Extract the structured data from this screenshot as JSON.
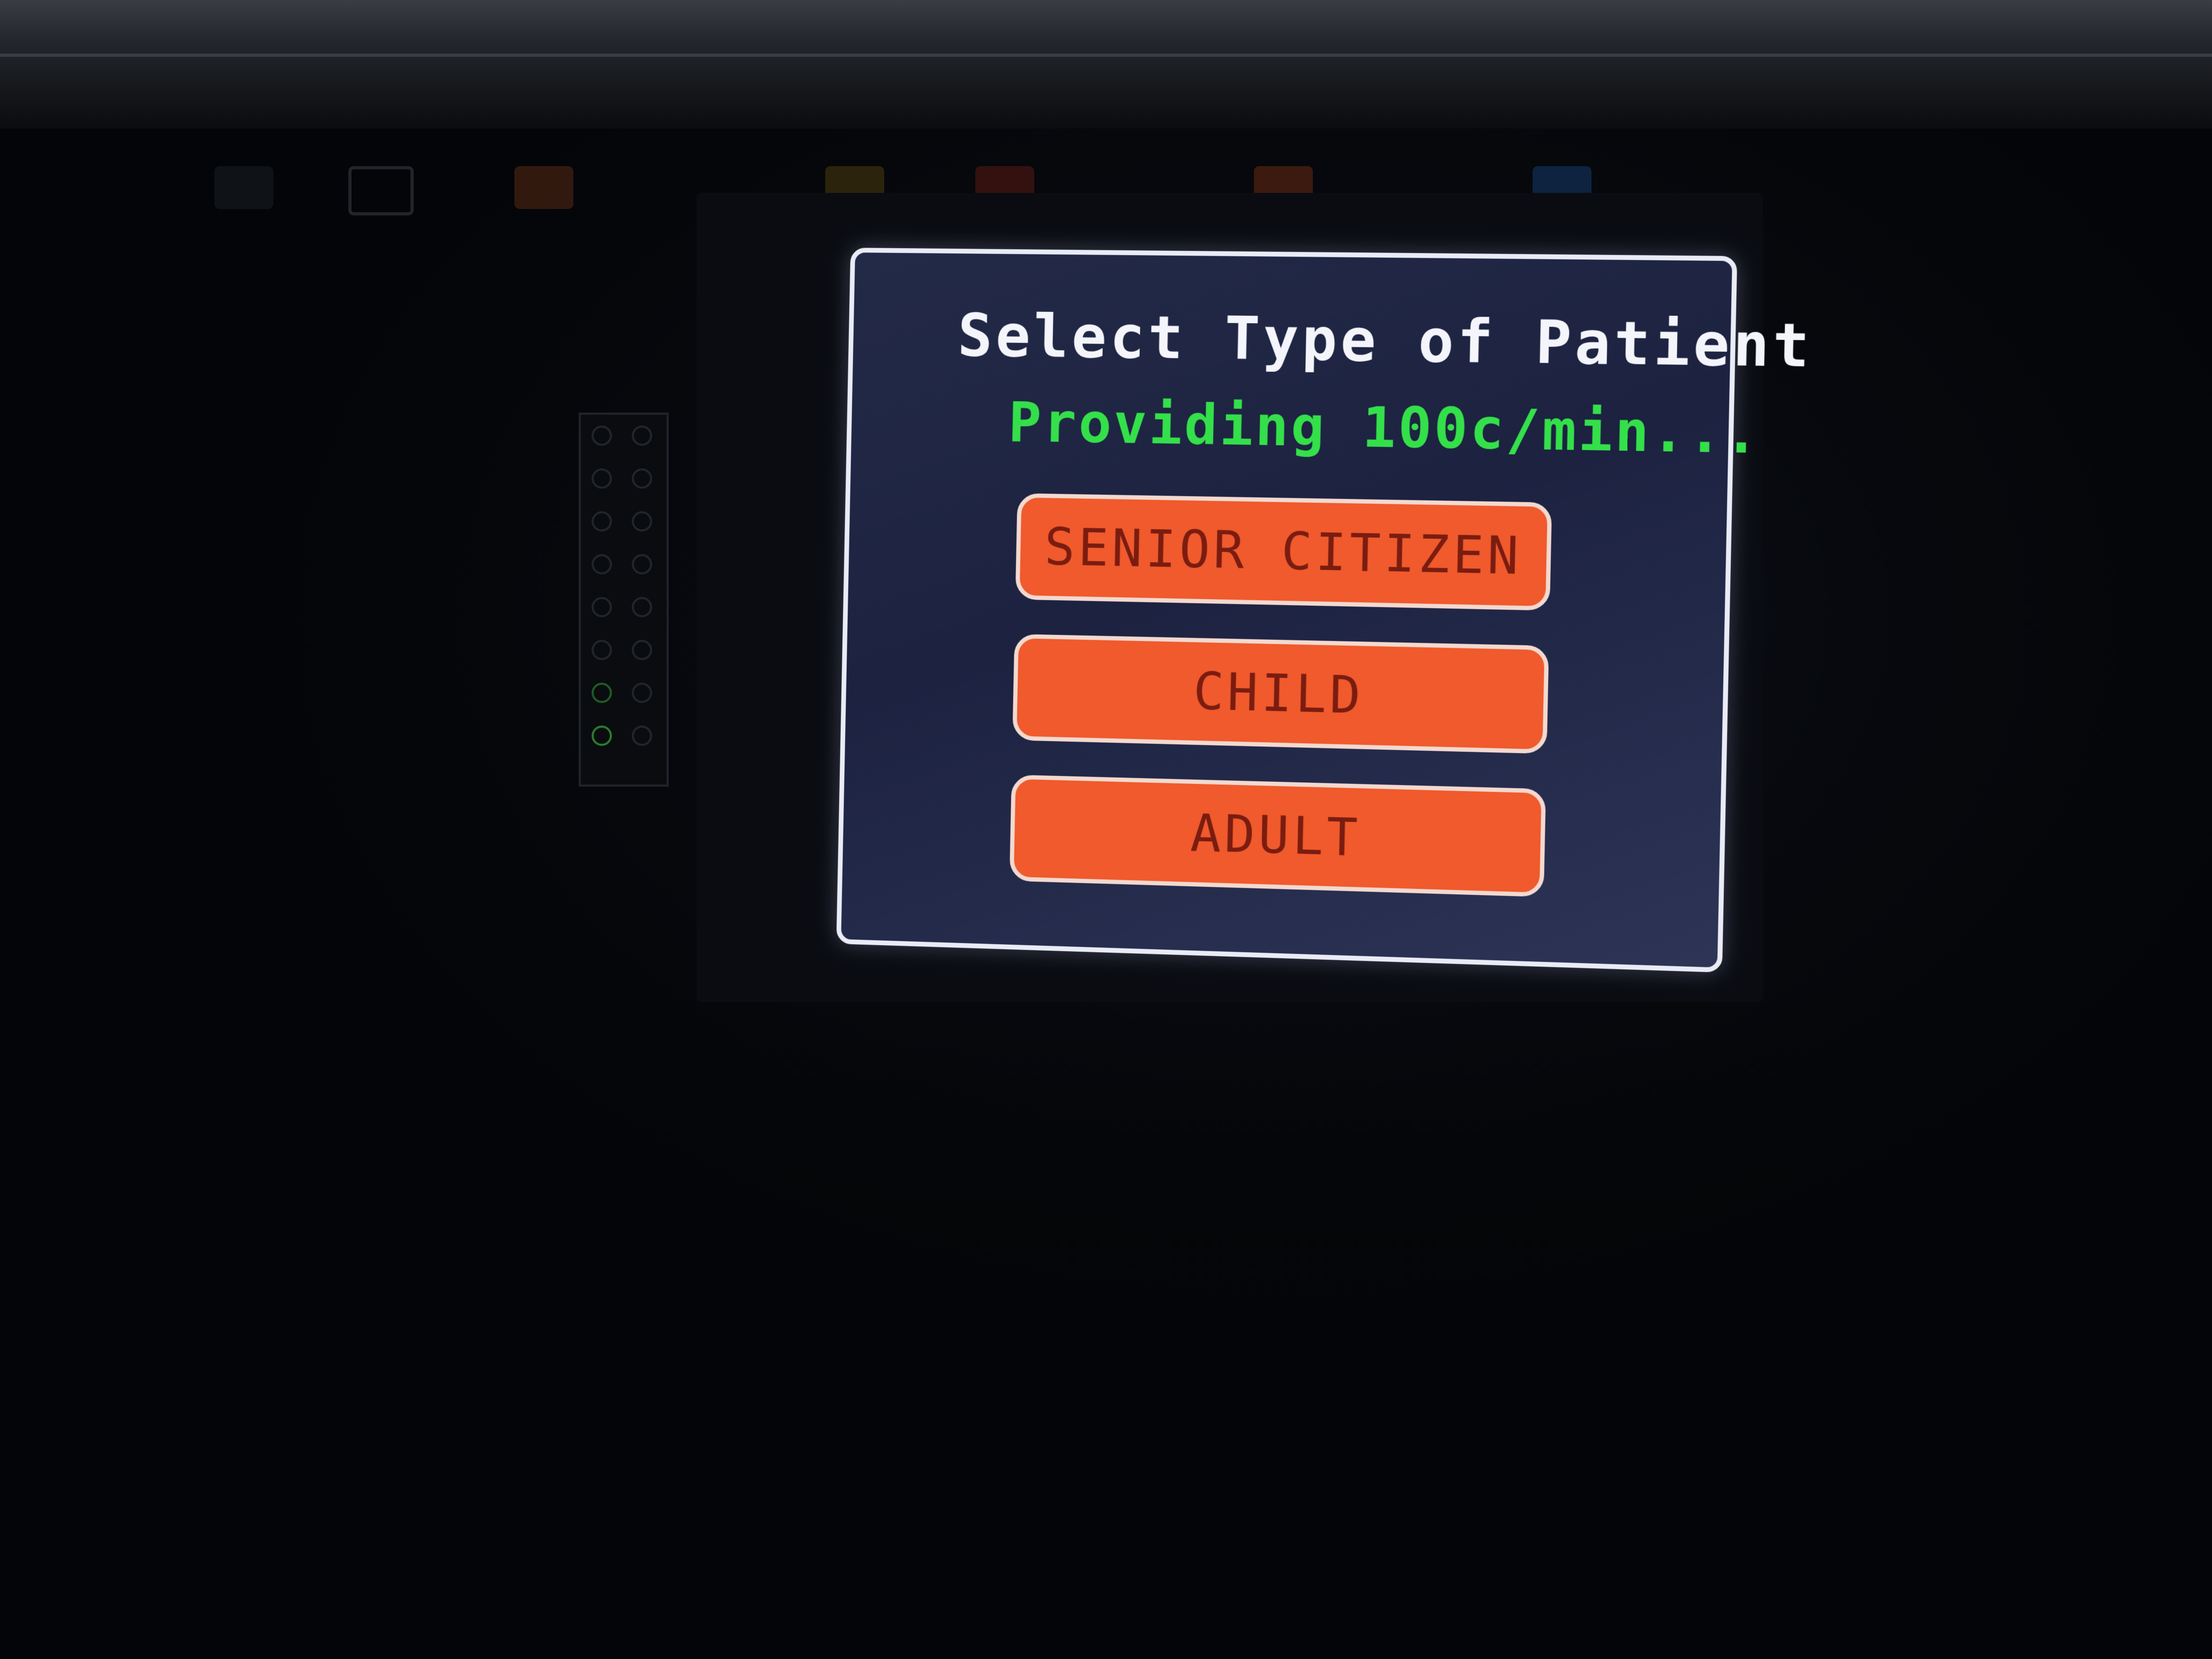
{
  "screen": {
    "title": "Select Type of Patient",
    "status": "Providing 100c/min...",
    "buttons": [
      {
        "label": "SENIOR CITIZEN"
      },
      {
        "label": "CHILD"
      },
      {
        "label": "ADULT"
      }
    ]
  },
  "colors": {
    "screen_bg": "#1f2542",
    "title": "#f4f5fb",
    "status": "#34e04a",
    "button_fill": "#f05a2c",
    "button_text": "#7a1c10",
    "border": "#e9ecf6"
  }
}
